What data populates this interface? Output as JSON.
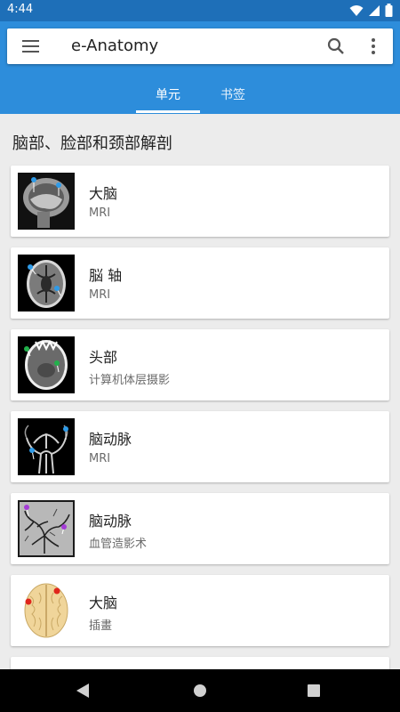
{
  "status": {
    "time": "4:44"
  },
  "appbar": {
    "title": "e-Anatomy"
  },
  "tabs": [
    {
      "label": "单元"
    },
    {
      "label": "书签"
    }
  ],
  "section": {
    "title": "脑部、脸部和颈部解剖"
  },
  "items": [
    {
      "title": "大脑",
      "subtitle": "MRI"
    },
    {
      "title": "脳 轴",
      "subtitle": "MRI"
    },
    {
      "title": "头部",
      "subtitle": "计算机体层摄影"
    },
    {
      "title": "脑动脉",
      "subtitle": "MRI"
    },
    {
      "title": "脑动脉",
      "subtitle": "血管造影术"
    },
    {
      "title": "大脑",
      "subtitle": "插畫"
    }
  ],
  "colors": {
    "appbar": "#2d8ddb",
    "statusbar": "#1e6fb8",
    "pin_blue": "#2f9be8",
    "pin_green": "#22b04b",
    "pin_purple": "#a43bd6",
    "pin_red": "#e0261c"
  }
}
